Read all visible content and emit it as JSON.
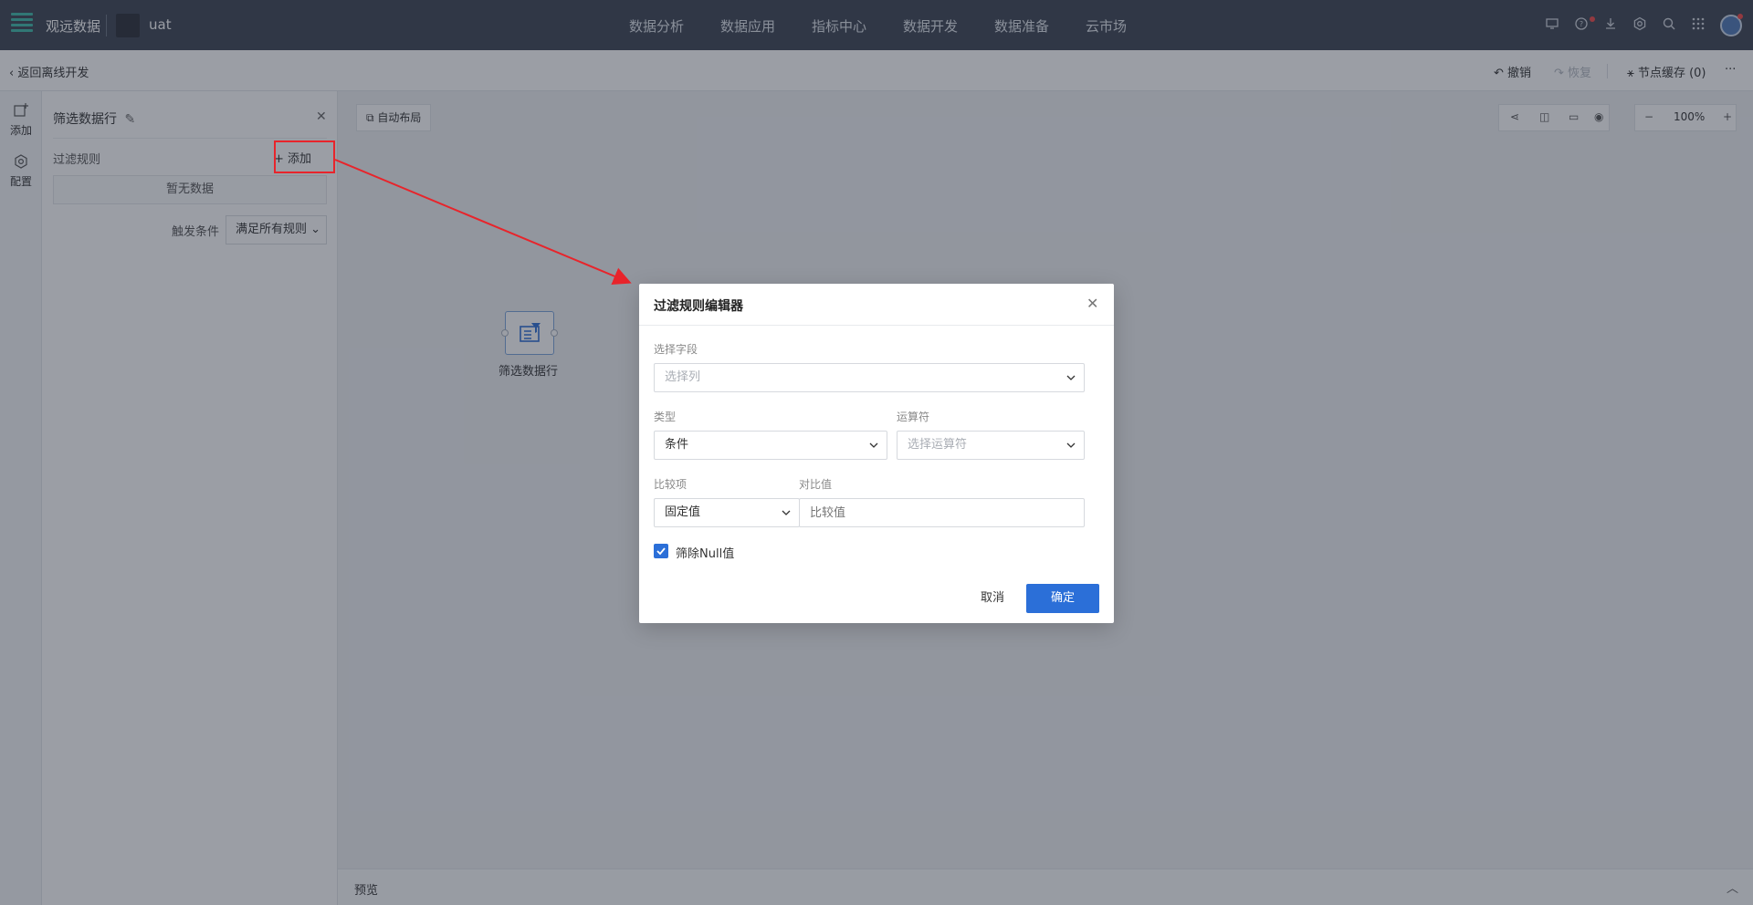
{
  "topnav": {
    "brand": "观远数据",
    "workspace": "uat",
    "menu": [
      "数据分析",
      "数据应用",
      "指标中心",
      "数据开发",
      "数据准备",
      "云市场"
    ],
    "icons": [
      "monitor-icon",
      "help-icon",
      "download-icon",
      "gear-icon",
      "search-icon",
      "apps-grid-icon"
    ]
  },
  "subbar": {
    "back_label": "返回离线开发",
    "undo_label": "撤销",
    "redo_label": "恢复",
    "cache_label": "节点缓存 (0)",
    "more_label": "···"
  },
  "rail": {
    "add_label": "添加",
    "config_label": "配置"
  },
  "panel": {
    "title": "筛选数据行",
    "rules_label": "过滤规则",
    "add_label": "添加",
    "empty_text": "暂无数据",
    "trigger_label": "触发条件",
    "trigger_value": "满足所有规则"
  },
  "canvas": {
    "autolayout_label": "自动布局",
    "zoom": "100%",
    "node_label": "筛选数据行",
    "preview_label": "预览"
  },
  "modal": {
    "title": "过滤规则编辑器",
    "field_label": "选择字段",
    "field_placeholder": "选择列",
    "type_label": "类型",
    "type_value": "条件",
    "operator_label": "运算符",
    "operator_placeholder": "选择运算符",
    "compare_label": "比较项",
    "compare_value": "固定值",
    "value_label": "对比值",
    "value_placeholder": "比较值",
    "exclude_null_label": "筛除Null值",
    "exclude_null_checked": true,
    "cancel_label": "取消",
    "ok_label": "确定"
  },
  "colors": {
    "topnav_bg": "#3c4452",
    "primary": "#2b6fd8",
    "highlight": "#e8242b",
    "logo": "#3fb8a8"
  }
}
